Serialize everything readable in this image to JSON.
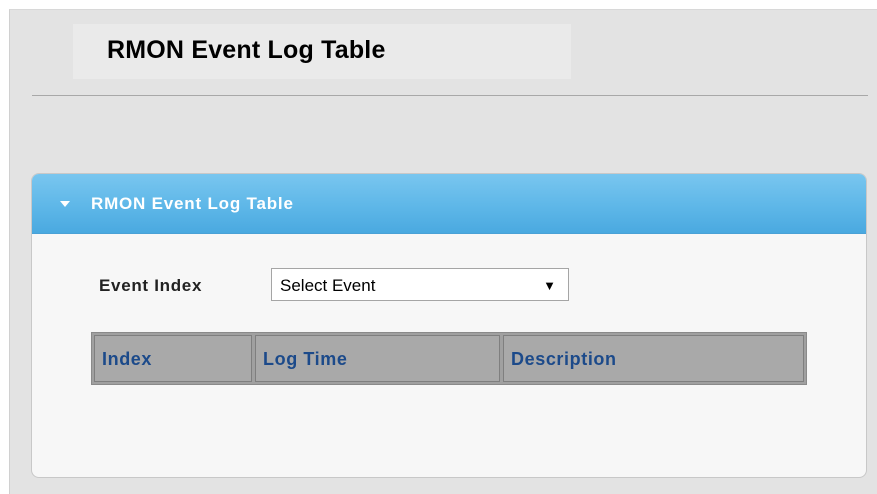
{
  "page": {
    "title": "RMON Event Log Table"
  },
  "panel": {
    "title": "RMON Event Log Table",
    "event_index": {
      "label": "Event Index",
      "selected": "Select Event"
    },
    "table": {
      "columns": [
        "Index",
        "Log Time",
        "Description"
      ],
      "rows": []
    }
  },
  "colors": {
    "panel_header": "#5eb7e8",
    "table_header_text": "#1c4a8a",
    "table_header_bg": "#a9a9a9"
  },
  "icons": {
    "panel_toggle": "triangle-down-icon",
    "select_caret": "caret-down-icon"
  }
}
